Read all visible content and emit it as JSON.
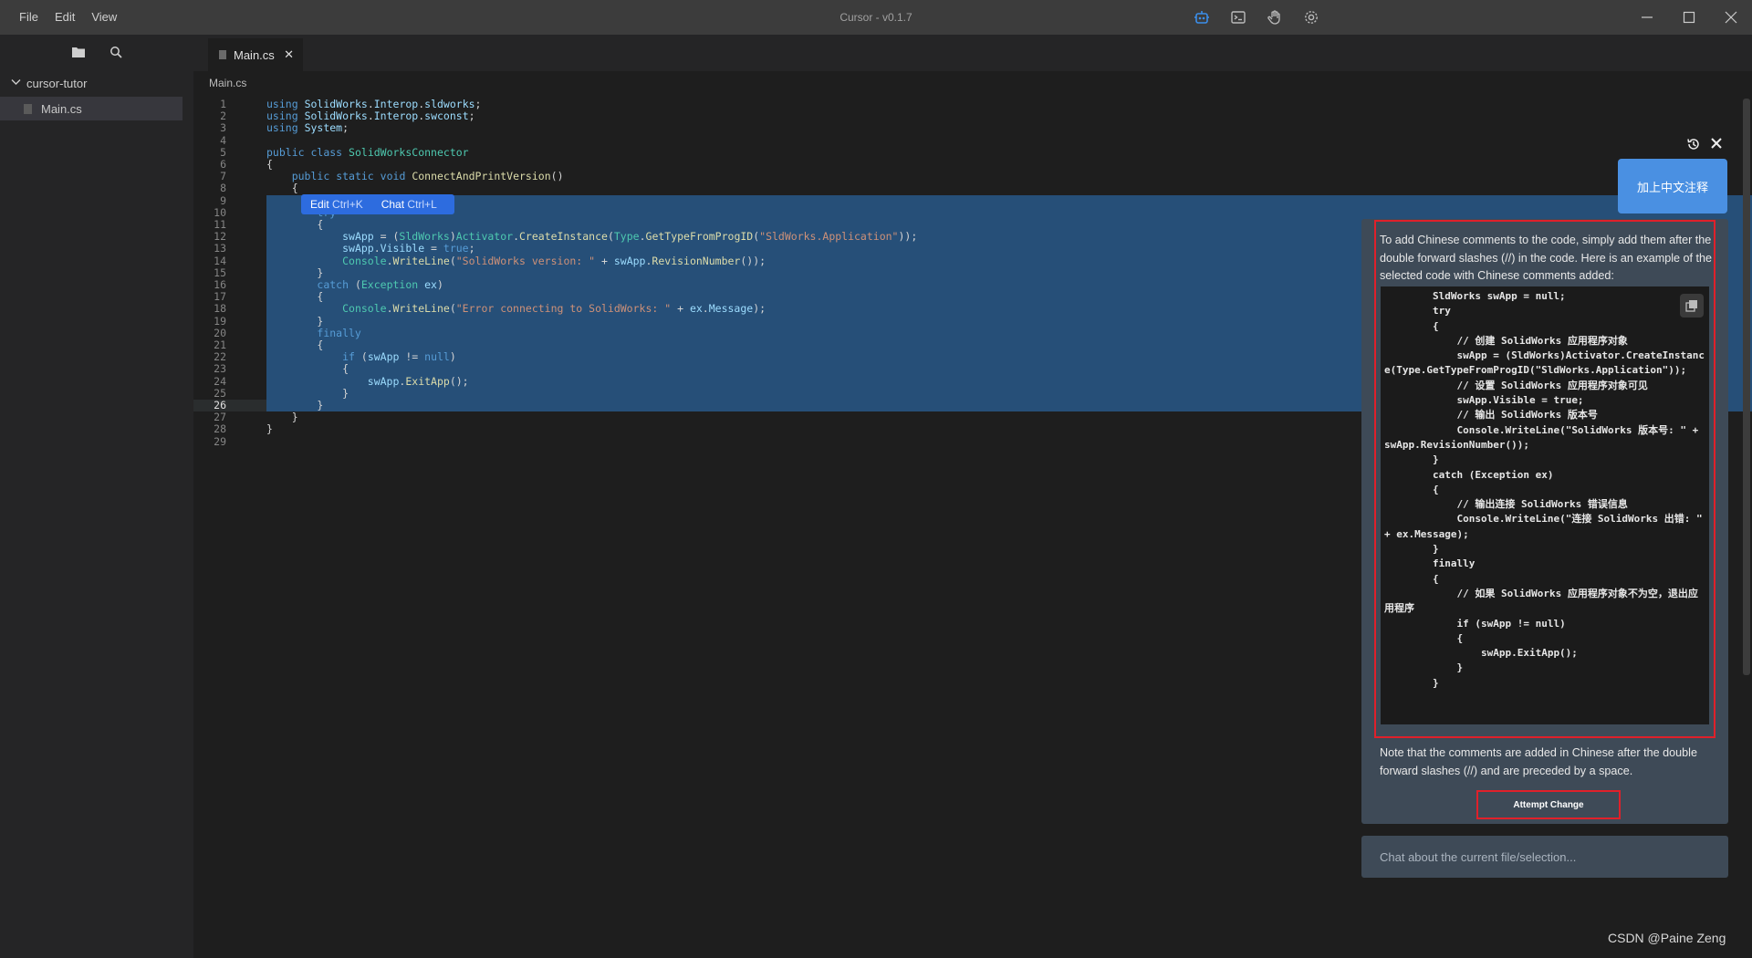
{
  "menu": {
    "file": "File",
    "edit": "Edit",
    "view": "View"
  },
  "window": {
    "title": "Cursor - v0.1.7"
  },
  "icons": {
    "chat": "robot-icon",
    "terminal": "terminal-icon",
    "hand": "hand-icon",
    "settings": "gear-icon",
    "minimize": "minimize-icon",
    "maximize": "maximize-icon",
    "close": "close-icon",
    "explorer": "folder-icon",
    "search": "search-icon",
    "history": "history-icon",
    "copy": "copy-icon"
  },
  "sidebar": {
    "folder": "cursor-tutor",
    "file": "Main.cs"
  },
  "tab": {
    "label": "Main.cs",
    "close": "✕"
  },
  "breadcrumb": "Main.cs",
  "editor": {
    "current_line": 26,
    "inline_menu": {
      "edit": "Edit",
      "edit_key": "Ctrl+K",
      "chat": "Chat",
      "chat_key": "Ctrl+L"
    },
    "lines": [
      "using SolidWorks.Interop.sldworks;",
      "using SolidWorks.Interop.swconst;",
      "using System;",
      "",
      "public class SolidWorksConnector",
      "{",
      "    public static void ConnectAndPrintVersion()",
      "    {",
      "        SldWorks swApp = null;",
      "        try",
      "        {",
      "            swApp = (SldWorks)Activator.CreateInstance(Type.GetTypeFromProgID(\"SldWorks.Application\"));",
      "            swApp.Visible = true;",
      "            Console.WriteLine(\"SolidWorks version: \" + swApp.RevisionNumber());",
      "        }",
      "        catch (Exception ex)",
      "        {",
      "            Console.WriteLine(\"Error connecting to SolidWorks: \" + ex.Message);",
      "        }",
      "        finally",
      "        {",
      "            if (swApp != null)",
      "            {",
      "                swApp.ExitApp();",
      "            }",
      "        }",
      "    }",
      "}",
      ""
    ]
  },
  "chat": {
    "user_message": "加上中文注释",
    "response_intro": "To add Chinese comments to the code, simply add them after the double forward slashes (//) in the code. Here is an example of the selected code with Chinese comments added:",
    "code_block": "        SldWorks swApp = null;\n        try\n        {\n            // 创建 SolidWorks 应用程序对象\n            swApp = (SldWorks)Activator.CreateInstance(Type.GetTypeFromProgID(\"SldWorks.Application\"));\n            // 设置 SolidWorks 应用程序对象可见\n            swApp.Visible = true;\n            // 输出 SolidWorks 版本号\n            Console.WriteLine(\"SolidWorks 版本号: \" + swApp.RevisionNumber());\n        }\n        catch (Exception ex)\n        {\n            // 输出连接 SolidWorks 错误信息\n            Console.WriteLine(\"连接 SolidWorks 出错: \" + ex.Message);\n        }\n        finally\n        {\n            // 如果 SolidWorks 应用程序对象不为空，退出应用程序\n            if (swApp != null)\n            {\n                swApp.ExitApp();\n            }\n        }",
    "response_note": "Note that the comments are added in Chinese after the double forward slashes (//) and are preceded by a space.",
    "attempt_change": "Attempt Change",
    "input_placeholder": "Chat about the current file/selection..."
  },
  "watermark": "CSDN @Paine Zeng"
}
